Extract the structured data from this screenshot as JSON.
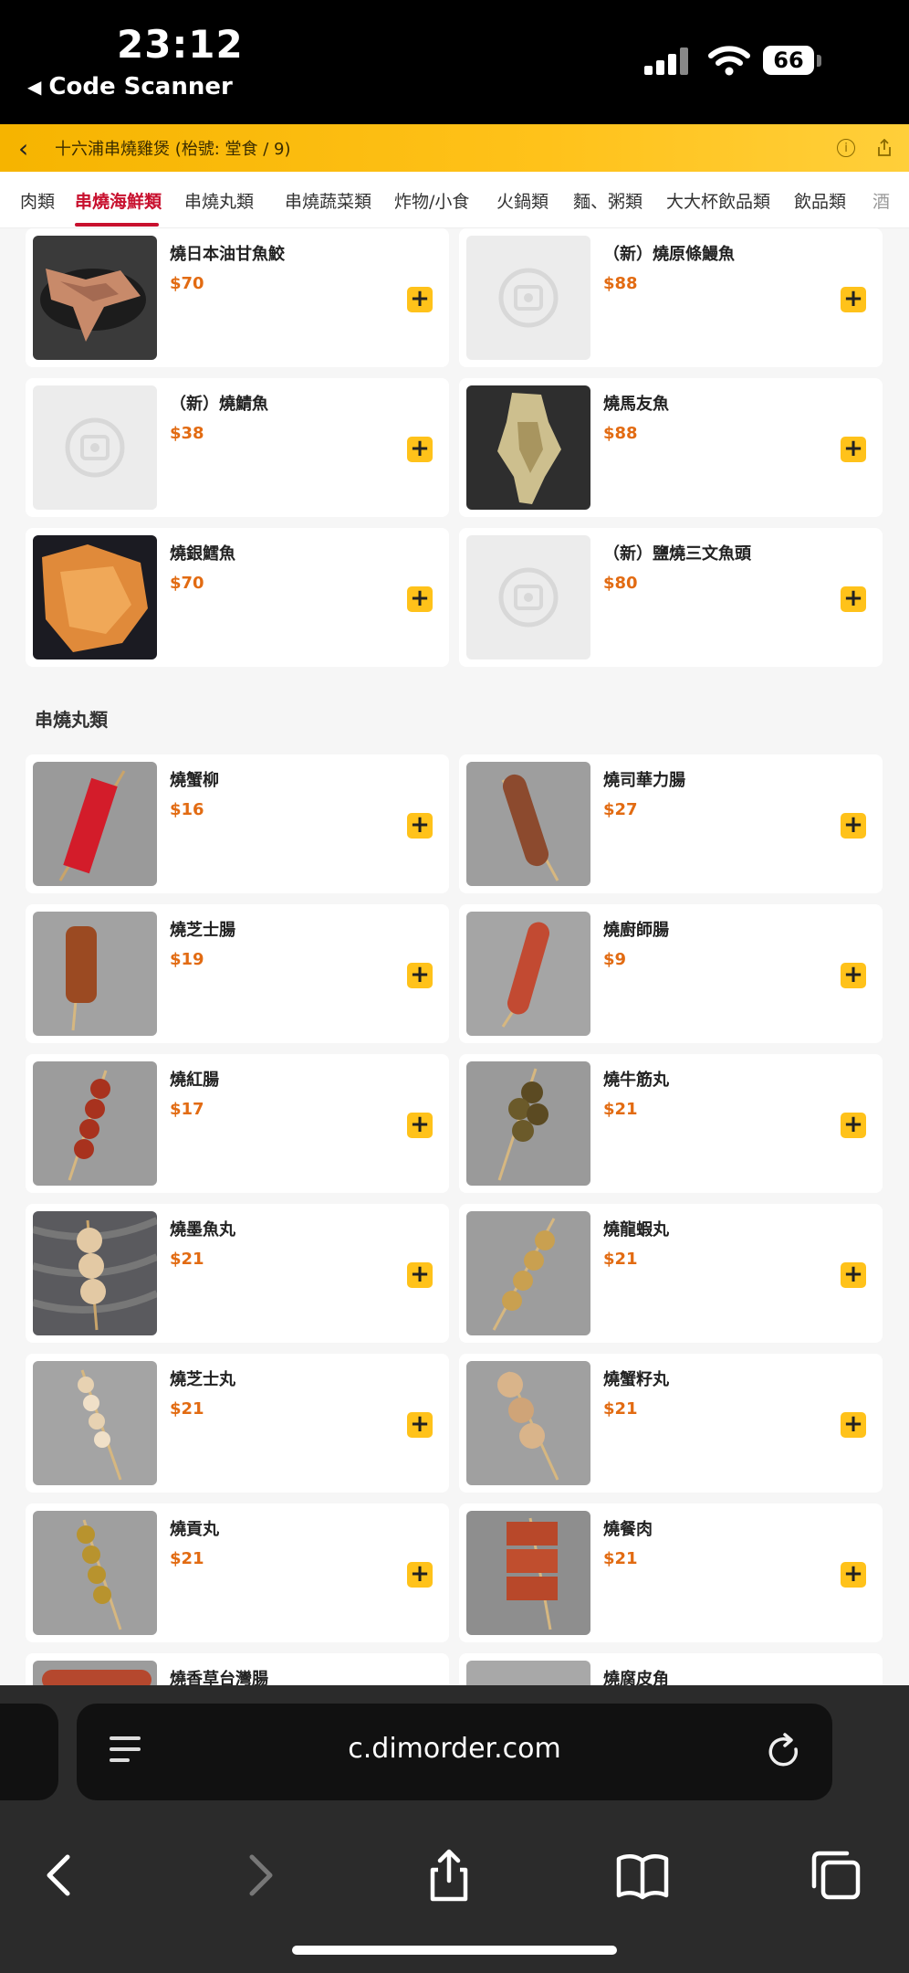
{
  "status_bar": {
    "time": "23:12",
    "back_app": "Code Scanner",
    "battery": "66"
  },
  "header": {
    "title": "十六浦串燒雞煲 (枱號: 堂食 / 9)"
  },
  "tabs": [
    "肉類",
    "串燒海鮮類",
    "串燒丸類",
    "串燒蔬菜類",
    "炸物/小食",
    "火鍋類",
    "麵、粥類",
    "大大杯飲品類",
    "飲品類",
    "酒"
  ],
  "active_tab": "串燒海鮮類",
  "seafood_items": [
    {
      "name": "燒日本油甘魚鮫",
      "price": "$70",
      "image": "photo"
    },
    {
      "name": "（新）燒原條鰻魚",
      "price": "$88",
      "image": "placeholder"
    },
    {
      "name": "（新）燒鯖魚",
      "price": "$38",
      "image": "placeholder"
    },
    {
      "name": "燒馬友魚",
      "price": "$88",
      "image": "photo"
    },
    {
      "name": "燒銀鱈魚",
      "price": "$70",
      "image": "photo"
    },
    {
      "name": "（新）鹽燒三文魚頭",
      "price": "$80",
      "image": "placeholder"
    }
  ],
  "section_balls": "串燒丸類",
  "ball_items": [
    {
      "name": "燒蟹柳",
      "price": "$16"
    },
    {
      "name": "燒司華力腸",
      "price": "$27"
    },
    {
      "name": "燒芝士腸",
      "price": "$19"
    },
    {
      "name": "燒廚師腸",
      "price": "$9"
    },
    {
      "name": "燒紅腸",
      "price": "$17"
    },
    {
      "name": "燒牛筋丸",
      "price": "$21"
    },
    {
      "name": "燒墨魚丸",
      "price": "$21"
    },
    {
      "name": "燒龍蝦丸",
      "price": "$21"
    },
    {
      "name": "燒芝士丸",
      "price": "$21"
    },
    {
      "name": "燒蟹籽丸",
      "price": "$21"
    },
    {
      "name": "燒貢丸",
      "price": "$21"
    },
    {
      "name": "燒餐肉",
      "price": "$21"
    },
    {
      "name": "燒香草台灣腸",
      "price": ""
    },
    {
      "name": "燒腐皮角",
      "price": ""
    }
  ],
  "add_symbol": "+",
  "browser": {
    "url": "c.dimorder.com"
  },
  "colors": {
    "accent": "#ffc21a",
    "price": "#e26b12",
    "active_tab": "#c8102e"
  }
}
